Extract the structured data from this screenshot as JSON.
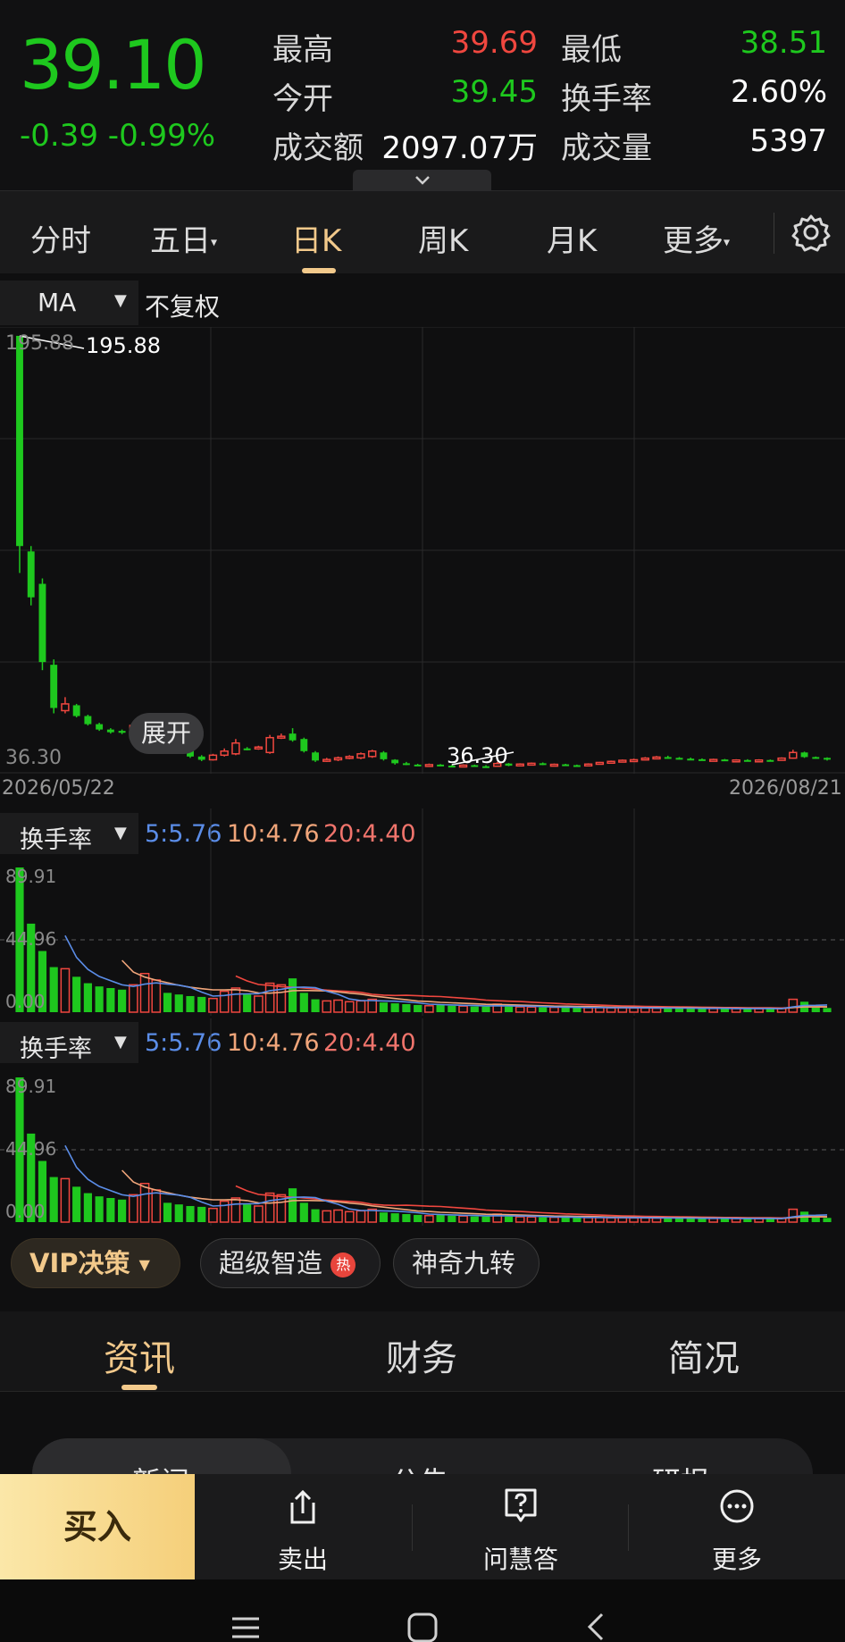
{
  "quote": {
    "price": "39.10",
    "change": "-0.39",
    "change_pct": "-0.99%",
    "high_label": "最高",
    "high": "39.69",
    "low_label": "最低",
    "low": "38.51",
    "open_label": "今开",
    "open": "39.45",
    "turnover_rate_label": "换手率",
    "turnover_rate": "2.60%",
    "amount_label": "成交额",
    "amount": "2097.07万",
    "volume_label": "成交量",
    "volume": "5397",
    "expand_icon": "chevron-down-icon"
  },
  "tabs": {
    "items": [
      {
        "label": "分时"
      },
      {
        "label": "五日"
      },
      {
        "label": "日K"
      },
      {
        "label": "周K"
      },
      {
        "label": "月K"
      },
      {
        "label": "更多"
      }
    ],
    "active_index": 2,
    "settings_icon": "gear-icon"
  },
  "chart_toolbar": {
    "indicator": "MA",
    "adjust": "不复权"
  },
  "kline": {
    "max_label": "195.88",
    "max_annotation": "195.88",
    "min_label": "36.30",
    "min_annotation": "36.30",
    "expand_button": "展开",
    "start_date": "2026/05/22",
    "end_date": "2026/08/21"
  },
  "indicator_panels": [
    {
      "name": "换手率",
      "ma5": "5:5.76",
      "ma10": "10:4.76",
      "ma20": "20:4.40",
      "top": "89.91",
      "mid": "44.96",
      "bottom": "0.00"
    },
    {
      "name": "换手率",
      "ma5": "5:5.76",
      "ma10": "10:4.76",
      "ma20": "20:4.40",
      "top": "89.91",
      "mid": "44.96",
      "bottom": "0.00"
    }
  ],
  "chart_data": {
    "type": "candlestick",
    "x_range": [
      "2026/05/22",
      "2026/08/21"
    ],
    "ylim": [
      36.3,
      195.88
    ],
    "candles": [
      {
        "o": 195.9,
        "c": 118.0,
        "h": 195.9,
        "l": 108.0,
        "dir": "down"
      },
      {
        "o": 116.0,
        "c": 99.0,
        "h": 118.0,
        "l": 96.0,
        "dir": "down"
      },
      {
        "o": 104.0,
        "c": 75.0,
        "h": 106.0,
        "l": 72.0,
        "dir": "down"
      },
      {
        "o": 74.0,
        "c": 58.0,
        "h": 76.0,
        "l": 56.0,
        "dir": "down"
      },
      {
        "o": 57.0,
        "c": 59.5,
        "h": 62.0,
        "l": 56.0,
        "dir": "up"
      },
      {
        "o": 59.0,
        "c": 55.0,
        "h": 59.5,
        "l": 54.5,
        "dir": "down"
      },
      {
        "o": 55.0,
        "c": 52.0,
        "h": 55.5,
        "l": 51.5,
        "dir": "down"
      },
      {
        "o": 52.0,
        "c": 50.0,
        "h": 52.5,
        "l": 49.5,
        "dir": "down"
      },
      {
        "o": 50.0,
        "c": 49.0,
        "h": 50.5,
        "l": 48.5,
        "dir": "down"
      },
      {
        "o": 49.5,
        "c": 48.8,
        "h": 50.0,
        "l": 48.3,
        "dir": "down"
      },
      {
        "o": 47.0,
        "c": 51.5,
        "h": 52.5,
        "l": 46.5,
        "dir": "up"
      },
      {
        "o": 50.0,
        "c": 52.0,
        "h": 54.0,
        "l": 49.5,
        "dir": "up"
      },
      {
        "o": 48.5,
        "c": 51.0,
        "h": 53.0,
        "l": 47.5,
        "dir": "up"
      },
      {
        "o": 51.0,
        "c": 48.5,
        "h": 52.0,
        "l": 48.0,
        "dir": "down"
      },
      {
        "o": 46.0,
        "c": 42.5,
        "h": 46.5,
        "l": 42.0,
        "dir": "down"
      },
      {
        "o": 42.5,
        "c": 40.0,
        "h": 43.0,
        "l": 39.5,
        "dir": "down"
      },
      {
        "o": 40.0,
        "c": 38.8,
        "h": 40.5,
        "l": 38.3,
        "dir": "down"
      },
      {
        "o": 38.8,
        "c": 40.5,
        "h": 41.0,
        "l": 38.5,
        "dir": "up"
      },
      {
        "o": 40.5,
        "c": 42.0,
        "h": 43.0,
        "l": 40.0,
        "dir": "up"
      },
      {
        "o": 41.0,
        "c": 45.0,
        "h": 46.5,
        "l": 40.5,
        "dir": "up"
      },
      {
        "o": 43.0,
        "c": 42.8,
        "h": 43.5,
        "l": 42.3,
        "dir": "down"
      },
      {
        "o": 43.0,
        "c": 43.5,
        "h": 44.0,
        "l": 42.5,
        "dir": "up"
      },
      {
        "o": 41.5,
        "c": 47.0,
        "h": 48.0,
        "l": 41.0,
        "dir": "up"
      },
      {
        "o": 47.0,
        "c": 47.5,
        "h": 48.5,
        "l": 46.5,
        "dir": "up"
      },
      {
        "o": 48.5,
        "c": 46.0,
        "h": 50.5,
        "l": 45.5,
        "dir": "down"
      },
      {
        "o": 46.5,
        "c": 42.0,
        "h": 47.0,
        "l": 41.5,
        "dir": "down"
      },
      {
        "o": 41.5,
        "c": 38.5,
        "h": 42.0,
        "l": 38.0,
        "dir": "down"
      },
      {
        "o": 38.5,
        "c": 38.9,
        "h": 39.5,
        "l": 38.0,
        "dir": "up"
      },
      {
        "o": 38.8,
        "c": 39.5,
        "h": 40.0,
        "l": 38.3,
        "dir": "up"
      },
      {
        "o": 39.5,
        "c": 40.0,
        "h": 40.5,
        "l": 39.0,
        "dir": "up"
      },
      {
        "o": 39.5,
        "c": 41.0,
        "h": 41.5,
        "l": 39.0,
        "dir": "up"
      },
      {
        "o": 40.0,
        "c": 42.0,
        "h": 42.5,
        "l": 39.5,
        "dir": "up"
      },
      {
        "o": 41.5,
        "c": 39.0,
        "h": 42.0,
        "l": 38.5,
        "dir": "down"
      },
      {
        "o": 38.8,
        "c": 37.5,
        "h": 39.0,
        "l": 37.0,
        "dir": "down"
      },
      {
        "o": 37.5,
        "c": 37.0,
        "h": 38.0,
        "l": 36.8,
        "dir": "down"
      },
      {
        "o": 37.0,
        "c": 36.7,
        "h": 37.3,
        "l": 36.5,
        "dir": "down"
      },
      {
        "o": 36.7,
        "c": 37.0,
        "h": 37.4,
        "l": 36.4,
        "dir": "up"
      },
      {
        "o": 37.0,
        "c": 36.6,
        "h": 37.2,
        "l": 36.4,
        "dir": "down"
      },
      {
        "o": 36.6,
        "c": 36.5,
        "h": 36.9,
        "l": 36.3,
        "dir": "down"
      },
      {
        "o": 36.5,
        "c": 36.8,
        "h": 37.1,
        "l": 36.3,
        "dir": "up"
      },
      {
        "o": 36.8,
        "c": 36.4,
        "h": 37.0,
        "l": 36.3,
        "dir": "down"
      },
      {
        "o": 36.4,
        "c": 36.4,
        "h": 36.8,
        "l": 36.3,
        "dir": "down"
      },
      {
        "o": 36.4,
        "c": 37.4,
        "h": 38.0,
        "l": 36.3,
        "dir": "up"
      },
      {
        "o": 37.4,
        "c": 36.6,
        "h": 37.6,
        "l": 36.4,
        "dir": "down"
      },
      {
        "o": 36.6,
        "c": 37.2,
        "h": 37.5,
        "l": 36.4,
        "dir": "up"
      },
      {
        "o": 37.2,
        "c": 37.5,
        "h": 37.8,
        "l": 36.9,
        "dir": "up"
      },
      {
        "o": 37.5,
        "c": 37.0,
        "h": 37.8,
        "l": 36.8,
        "dir": "down"
      },
      {
        "o": 37.0,
        "c": 37.1,
        "h": 37.4,
        "l": 36.8,
        "dir": "up"
      },
      {
        "o": 37.1,
        "c": 36.8,
        "h": 37.3,
        "l": 36.6,
        "dir": "down"
      },
      {
        "o": 36.8,
        "c": 36.6,
        "h": 37.0,
        "l": 36.4,
        "dir": "down"
      },
      {
        "o": 36.6,
        "c": 37.2,
        "h": 37.5,
        "l": 36.4,
        "dir": "up"
      },
      {
        "o": 37.2,
        "c": 37.8,
        "h": 38.0,
        "l": 37.0,
        "dir": "up"
      },
      {
        "o": 37.8,
        "c": 38.2,
        "h": 38.5,
        "l": 37.5,
        "dir": "up"
      },
      {
        "o": 38.2,
        "c": 38.6,
        "h": 38.9,
        "l": 38.0,
        "dir": "up"
      },
      {
        "o": 38.6,
        "c": 38.8,
        "h": 39.2,
        "l": 38.3,
        "dir": "up"
      },
      {
        "o": 38.8,
        "c": 39.4,
        "h": 39.8,
        "l": 38.6,
        "dir": "up"
      },
      {
        "o": 39.4,
        "c": 39.8,
        "h": 40.2,
        "l": 39.0,
        "dir": "up"
      },
      {
        "o": 39.8,
        "c": 39.5,
        "h": 40.3,
        "l": 39.2,
        "dir": "down"
      },
      {
        "o": 39.5,
        "c": 39.2,
        "h": 39.8,
        "l": 38.9,
        "dir": "down"
      },
      {
        "o": 39.2,
        "c": 39.0,
        "h": 39.6,
        "l": 38.8,
        "dir": "down"
      },
      {
        "o": 39.0,
        "c": 38.8,
        "h": 39.3,
        "l": 38.5,
        "dir": "down"
      },
      {
        "o": 38.8,
        "c": 38.9,
        "h": 39.2,
        "l": 38.5,
        "dir": "up"
      },
      {
        "o": 38.9,
        "c": 38.5,
        "h": 39.1,
        "l": 38.3,
        "dir": "down"
      },
      {
        "o": 38.5,
        "c": 38.7,
        "h": 39.0,
        "l": 38.3,
        "dir": "up"
      },
      {
        "o": 38.7,
        "c": 38.6,
        "h": 39.0,
        "l": 38.4,
        "dir": "down"
      },
      {
        "o": 38.6,
        "c": 38.7,
        "h": 39.0,
        "l": 38.4,
        "dir": "up"
      },
      {
        "o": 38.7,
        "c": 38.6,
        "h": 38.9,
        "l": 38.4,
        "dir": "down"
      },
      {
        "o": 38.6,
        "c": 39.4,
        "h": 39.7,
        "l": 38.5,
        "dir": "up"
      },
      {
        "o": 39.4,
        "c": 41.5,
        "h": 42.5,
        "l": 39.2,
        "dir": "up"
      },
      {
        "o": 41.5,
        "c": 39.8,
        "h": 41.8,
        "l": 39.5,
        "dir": "down"
      },
      {
        "o": 39.8,
        "c": 39.5,
        "h": 40.0,
        "l": 39.2,
        "dir": "down"
      },
      {
        "o": 39.5,
        "c": 39.1,
        "h": 39.7,
        "l": 38.5,
        "dir": "down"
      }
    ],
    "turnover": [
      89.9,
      55.0,
      38.0,
      28.0,
      27.0,
      22.0,
      18.0,
      16.0,
      15.0,
      14.0,
      17.0,
      24.0,
      20.0,
      12.0,
      11.0,
      10.0,
      9.5,
      8.5,
      13.0,
      15.0,
      11.0,
      10.0,
      18.0,
      17.0,
      21.0,
      12.0,
      8.0,
      7.0,
      7.5,
      6.5,
      7.0,
      8.0,
      6.0,
      5.5,
      5.0,
      4.5,
      4.0,
      4.5,
      4.0,
      3.8,
      3.5,
      3.5,
      5.0,
      3.5,
      3.3,
      3.2,
      3.0,
      3.0,
      3.0,
      2.8,
      2.8,
      2.8,
      2.7,
      2.7,
      2.6,
      2.6,
      2.5,
      2.5,
      2.4,
      2.4,
      2.4,
      2.3,
      2.3,
      2.3,
      2.2,
      2.2,
      2.2,
      2.3,
      8.0,
      6.5,
      3.0,
      2.6
    ],
    "ma5_turnover": [
      null,
      null,
      null,
      null,
      47.6,
      34.0,
      26.6,
      22.2,
      19.6,
      17.0,
      16.0,
      17.4,
      18.2,
      17.4,
      16.8,
      15.4,
      12.5,
      10.0,
      10.4,
      11.2,
      11.4,
      11.5,
      13.4,
      14.2,
      15.4,
      15.6,
      15.2,
      13.0,
      11.1,
      8.2,
      7.2,
      7.2,
      7.0,
      6.8,
      6.4,
      5.8,
      5.0,
      4.7,
      4.5,
      4.3,
      4.1,
      3.9,
      4.0,
      3.9,
      3.8,
      3.7,
      3.5,
      3.2,
      3.1,
      3.0,
      2.9,
      2.9,
      2.8,
      2.8,
      2.7,
      2.7,
      2.6,
      2.6,
      2.5,
      2.5,
      2.4,
      2.4,
      2.4,
      2.3,
      2.3,
      2.3,
      2.3,
      2.2,
      3.3,
      4.2,
      4.3,
      4.5
    ],
    "ma10_turnover": [
      null,
      null,
      null,
      null,
      null,
      null,
      null,
      null,
      null,
      32.2,
      24.9,
      21.8,
      19.9,
      18.3,
      16.7,
      15.5,
      14.6,
      13.9,
      13.9,
      14.0,
      13.4,
      12.0,
      11.8,
      12.3,
      13.3,
      13.5,
      13.4,
      13.2,
      12.6,
      11.8,
      11.2,
      10.1,
      9.3,
      8.5,
      7.7,
      6.9,
      6.6,
      6.1,
      5.8,
      5.5,
      5.2,
      4.9,
      4.8,
      4.6,
      4.4,
      4.2,
      4.0,
      3.8,
      3.7,
      3.6,
      3.5,
      3.4,
      3.1,
      3.1,
      3.0,
      2.9,
      2.9,
      2.8,
      2.7,
      2.7,
      2.6,
      2.6,
      2.5,
      2.5,
      2.4,
      2.4,
      2.4,
      2.3,
      2.9,
      3.3,
      3.4,
      3.4
    ],
    "ma20_turnover": [
      null,
      null,
      null,
      null,
      null,
      null,
      null,
      null,
      null,
      null,
      null,
      null,
      null,
      null,
      null,
      null,
      null,
      null,
      null,
      22.5,
      19.4,
      17.2,
      16.6,
      15.9,
      15.5,
      15.0,
      14.4,
      13.7,
      13.2,
      12.9,
      12.3,
      11.1,
      10.6,
      10.4,
      10.5,
      10.2,
      9.9,
      9.7,
      9.2,
      8.7,
      8.2,
      7.5,
      7.1,
      6.8,
      6.6,
      6.2,
      5.8,
      5.5,
      5.1,
      4.9,
      4.6,
      4.4,
      4.1,
      3.9,
      3.8,
      3.6,
      3.5,
      3.4,
      3.3,
      3.2,
      3.1,
      3.0,
      2.9,
      2.9,
      2.8,
      2.7,
      2.7,
      2.6,
      2.9,
      3.2,
      3.2,
      3.2
    ]
  },
  "vip_row": {
    "vip": "VIP决策",
    "smart": "超级智造",
    "hot_badge": "热",
    "magic": "神奇九转"
  },
  "lower_tabs": {
    "items": [
      "资讯",
      "财务",
      "简况"
    ],
    "active_index": 0,
    "sub": [
      "新闻",
      "公告",
      "研报"
    ]
  },
  "actions": {
    "buy": "买入",
    "sell": "卖出",
    "ask": "问慧答",
    "more": "更多"
  },
  "colors": {
    "up": "#f0473f",
    "down": "#1ec81e",
    "accent": "#f2c98b",
    "ma5": "#5b8de8",
    "ma10": "#f0a57a",
    "ma20": "#f0473f"
  }
}
